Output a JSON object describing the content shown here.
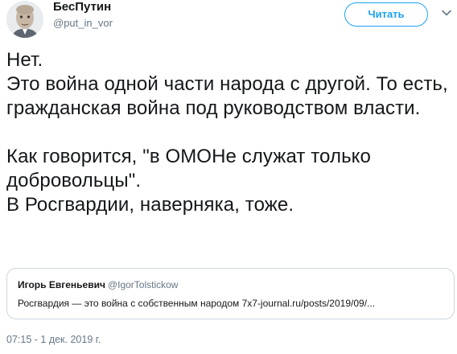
{
  "author": {
    "display_name": "БесПутин",
    "handle": "@put_in_vor"
  },
  "follow_button": {
    "label": "Читать"
  },
  "tweet": {
    "text": "Нет.\nЭто война одной части народа с другой. То есть, гражданская война под руководством власти.\n\nКак говорится, \"в ОМОНе служат только добровольцы\".\nВ Росгвардии, наверняка, тоже."
  },
  "quote": {
    "name": "Игорь Евгеньевич",
    "handle": "@IgorTolstickow",
    "text": "Росгвардия — это война с собственным народом 7x7-journal.ru/posts/2019/09/..."
  },
  "timestamp": "07:15 - 1 дек. 2019 г.",
  "colors": {
    "accent": "#1da1f2",
    "text": "#14171a",
    "secondary": "#657786",
    "border": "#ccd6dd"
  },
  "icons": {
    "avatar": "avatar",
    "menu": "chevron-down-icon"
  }
}
